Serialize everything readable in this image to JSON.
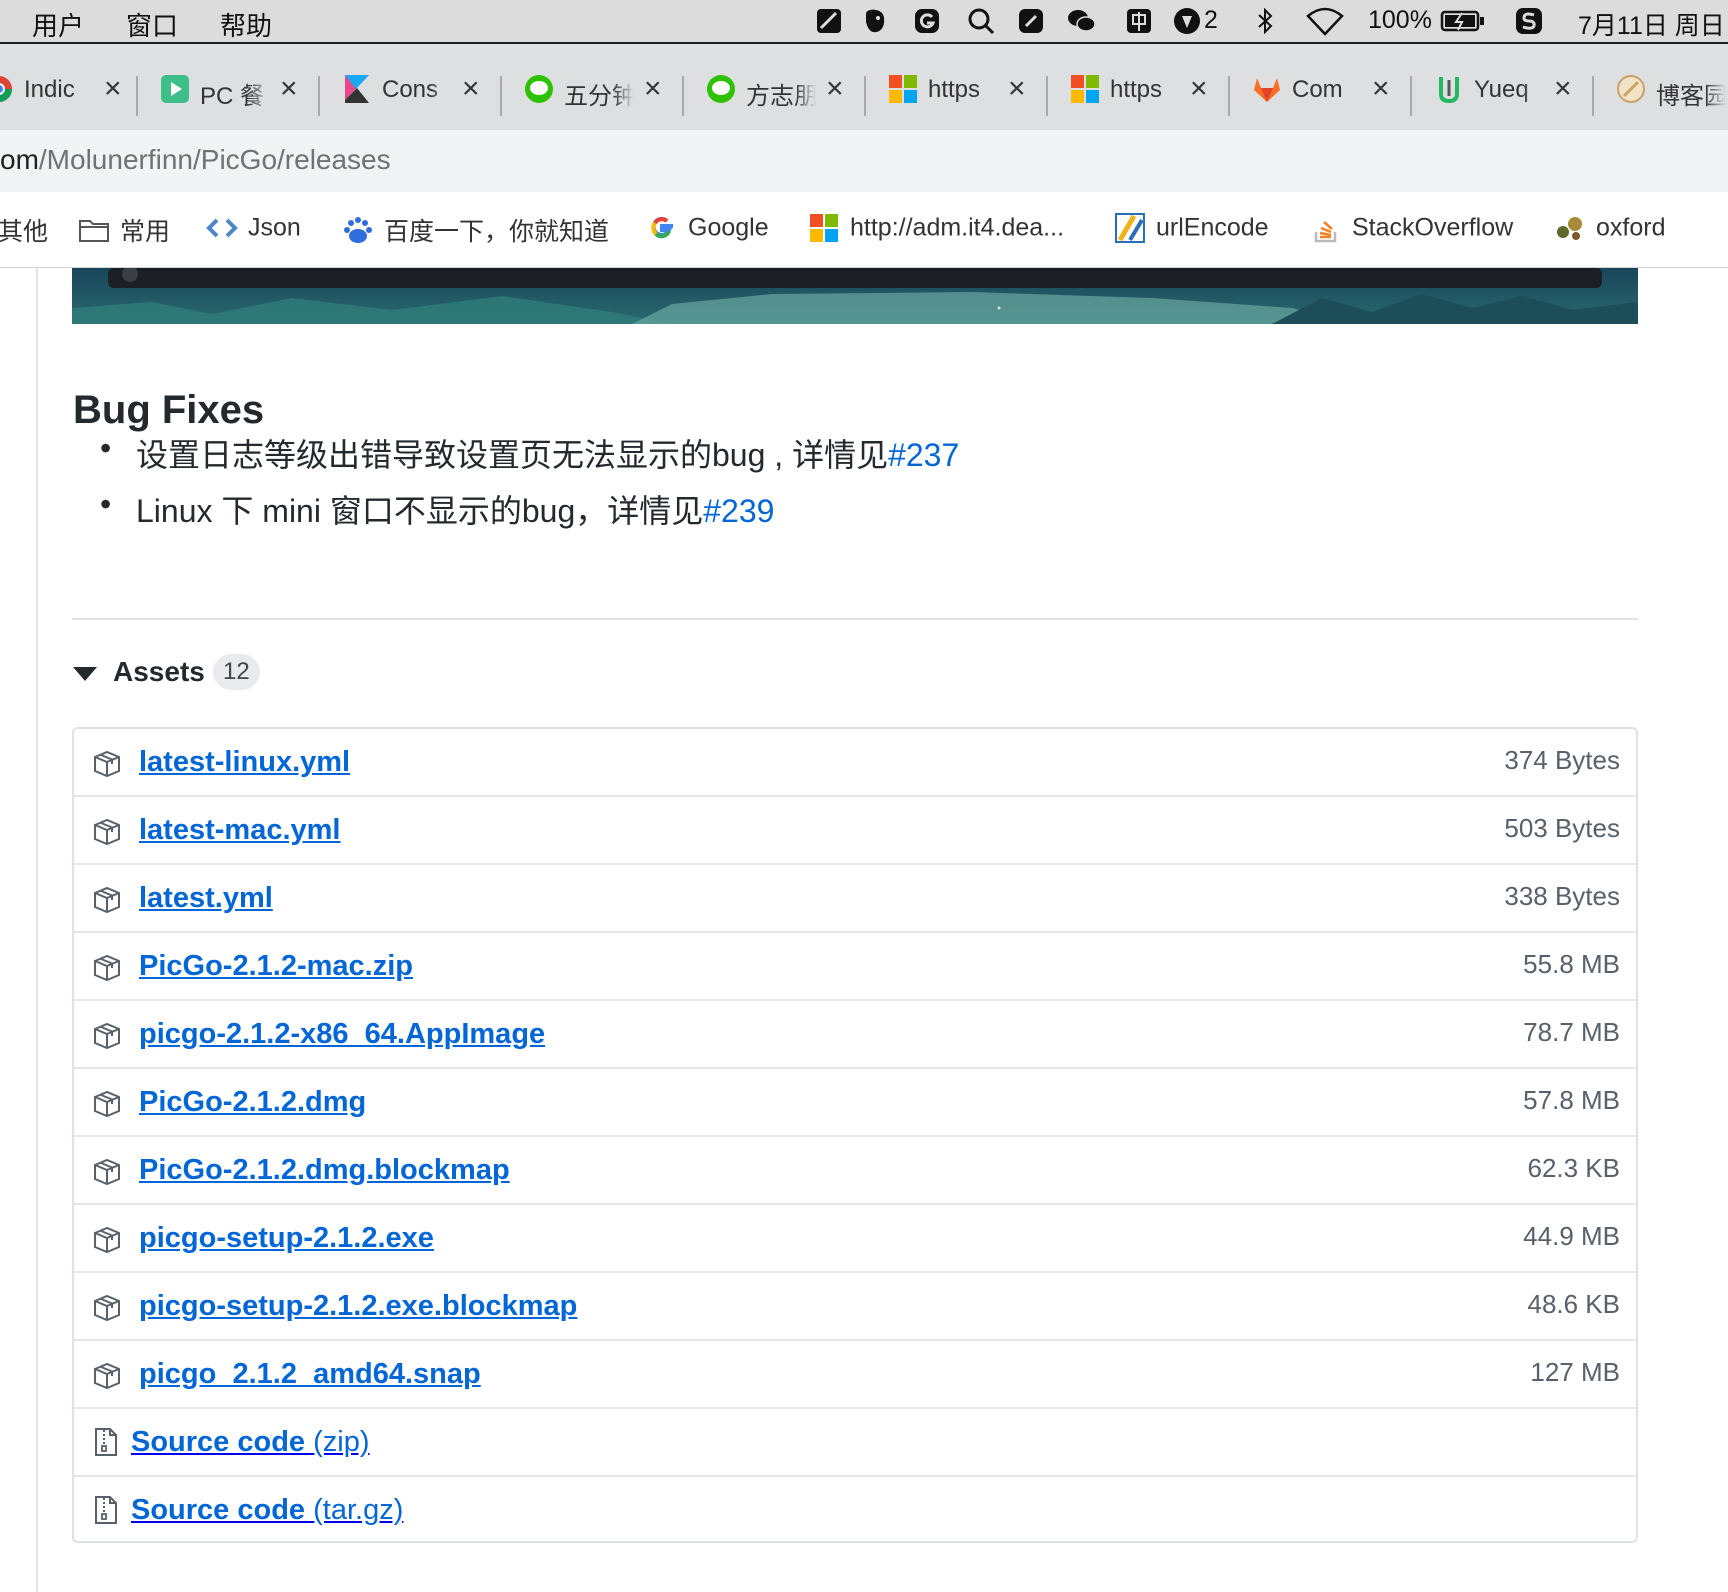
{
  "menubar": {
    "items": [
      "用户",
      "窗口",
      "帮助"
    ],
    "notification_count": "2",
    "battery": "100%",
    "clock": "7月11日 周日"
  },
  "tabs": [
    {
      "title": "Indic",
      "icon": "chrome-icon"
    },
    {
      "title": "PC 餐",
      "icon": "play-store-icon"
    },
    {
      "title": "Cons",
      "icon": "kibana-icon"
    },
    {
      "title": "五分钟",
      "icon": "wechat-icon"
    },
    {
      "title": "方志朋",
      "icon": "wechat-icon"
    },
    {
      "title": "https",
      "icon": "colorful-squares-icon"
    },
    {
      "title": "https",
      "icon": "colorful-squares-icon"
    },
    {
      "title": "Com",
      "icon": "gitlab-icon"
    },
    {
      "title": "Yueq",
      "icon": "yuque-icon"
    },
    {
      "title": "博客园",
      "icon": "blog-icon"
    }
  ],
  "address": {
    "host": "om",
    "path": "/Molunerfinn/PicGo/releases"
  },
  "bookmarks": [
    {
      "label": "其他",
      "icon": ""
    },
    {
      "label": "常用",
      "icon": "folder-icon"
    },
    {
      "label": "Json",
      "icon": "code-icon"
    },
    {
      "label": "百度一下，你就知道",
      "icon": "baidu-icon"
    },
    {
      "label": "Google",
      "icon": "google-icon"
    },
    {
      "label": "http://adm.it4.dea...",
      "icon": "colorful-squares-icon"
    },
    {
      "label": "urlEncode",
      "icon": "urlencode-icon"
    },
    {
      "label": "StackOverflow",
      "icon": "stackoverflow-icon"
    },
    {
      "label": "oxford",
      "icon": "oxford-icon"
    }
  ],
  "release": {
    "bug_fixes_title": "Bug Fixes",
    "bug_fixes": [
      {
        "text": "设置日志等级出错导致设置页无法显示的bug , 详情见",
        "link": "#237"
      },
      {
        "text": "Linux 下 mini 窗口不显示的bug，详情见",
        "link": "#239"
      }
    ],
    "assets_title": "Assets",
    "assets_count": "12",
    "assets": [
      {
        "name": "latest-linux.yml",
        "size": "374 Bytes"
      },
      {
        "name": "latest-mac.yml",
        "size": "503 Bytes"
      },
      {
        "name": "latest.yml",
        "size": "338 Bytes"
      },
      {
        "name": "PicGo-2.1.2-mac.zip",
        "size": "55.8 MB"
      },
      {
        "name": "picgo-2.1.2-x86_64.AppImage",
        "size": "78.7 MB"
      },
      {
        "name": "PicGo-2.1.2.dmg",
        "size": "57.8 MB"
      },
      {
        "name": "PicGo-2.1.2.dmg.blockmap",
        "size": "62.3 KB"
      },
      {
        "name": "picgo-setup-2.1.2.exe",
        "size": "44.9 MB"
      },
      {
        "name": "picgo-setup-2.1.2.exe.blockmap",
        "size": "48.6 KB"
      },
      {
        "name": "picgo_2.1.2_amd64.snap",
        "size": "127 MB"
      }
    ],
    "source_code": [
      {
        "label": "Source code",
        "format": "(zip)"
      },
      {
        "label": "Source code",
        "format": "(tar.gz)"
      }
    ]
  },
  "colors": {
    "link": "#0366d6",
    "text": "#24292e",
    "muted": "#586069",
    "border": "#e1e4e8"
  }
}
